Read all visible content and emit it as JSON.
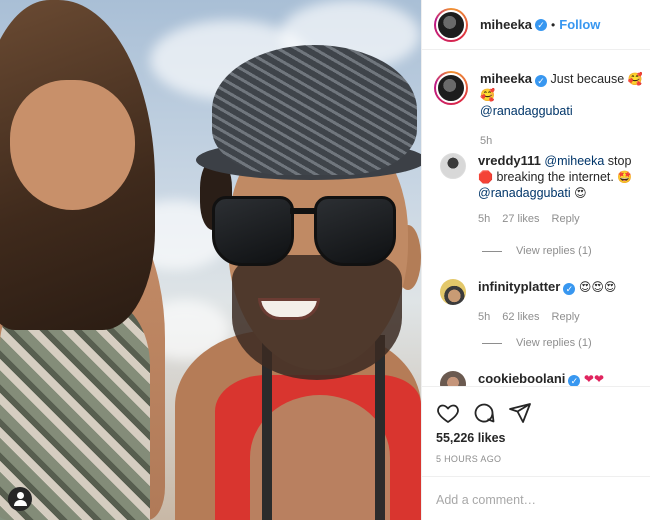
{
  "header": {
    "username": "miheeka",
    "verified": true,
    "separator": "•",
    "follow_label": "Follow"
  },
  "caption": {
    "username": "miheeka",
    "verified": true,
    "text": "Just because",
    "emoji": "🥰🥰",
    "mention": "@ranadaggubati",
    "time": "5h"
  },
  "comments": [
    {
      "username": "vreddy111",
      "verified": false,
      "mention": "@miheeka",
      "text_before": "stop",
      "emoji_1": "🛑",
      "text_after": "breaking the internet.",
      "emoji_2": "🤩",
      "mention_2": "@ranadaggubati",
      "emoji_3": "😍",
      "time": "5h",
      "likes": "27 likes",
      "reply_label": "Reply",
      "view_replies": "View replies (1)"
    },
    {
      "username": "infinityplatter",
      "verified": true,
      "emoji": "😍😍😍",
      "time": "5h",
      "likes": "62 likes",
      "reply_label": "Reply",
      "view_replies": "View replies (1)"
    },
    {
      "username": "cookieboolani",
      "verified": true,
      "emoji": "❤❤"
    }
  ],
  "actions": {
    "like_count": "55,226 likes",
    "time_ago": "5 HOURS AGO"
  },
  "add_comment": {
    "placeholder": "Add a comment…"
  },
  "colors": {
    "accent": "#3897f0",
    "mention": "#003569",
    "muted": "#8e8e8e"
  }
}
